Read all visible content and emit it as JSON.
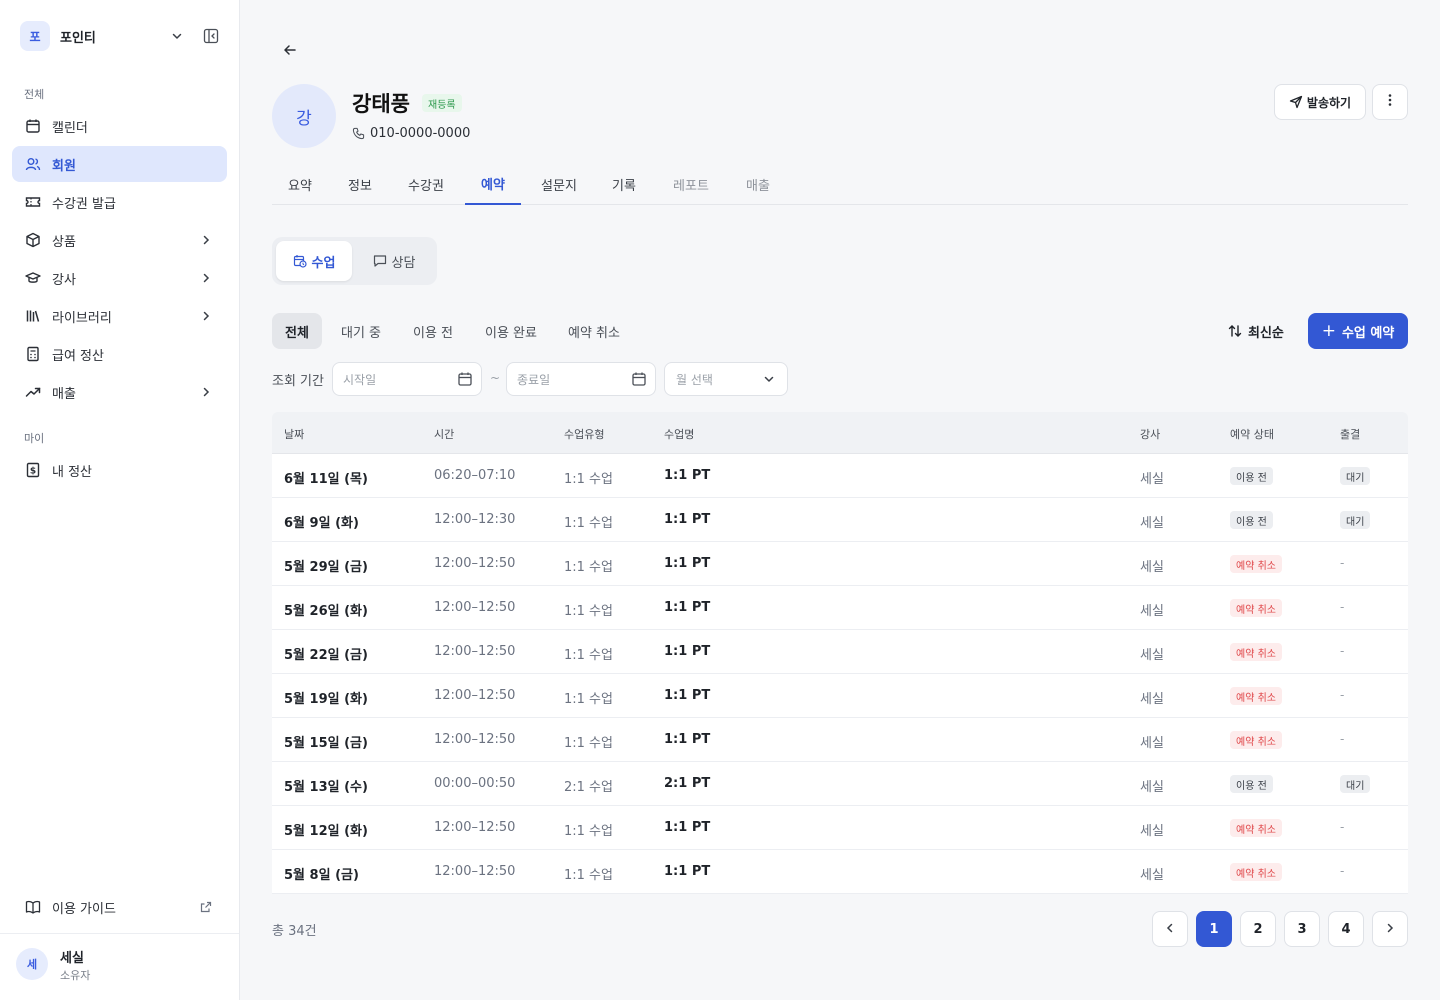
{
  "sidebar": {
    "workspace": {
      "initial": "포",
      "name": "포인티"
    },
    "section_all": "전체",
    "section_my": "마이",
    "items": [
      {
        "label": "캘린더"
      },
      {
        "label": "회원"
      },
      {
        "label": "수강권 발급"
      },
      {
        "label": "상품"
      },
      {
        "label": "강사"
      },
      {
        "label": "라이브러리"
      },
      {
        "label": "급여 정산"
      },
      {
        "label": "매출"
      }
    ],
    "my_items": [
      {
        "label": "내 정산"
      }
    ],
    "guide": {
      "label": "이용 가이드"
    },
    "user": {
      "initial": "세",
      "name": "세실",
      "role": "소유자"
    }
  },
  "member": {
    "initial": "강",
    "name": "강태풍",
    "badge": "재등록",
    "phone": "010-0000-0000"
  },
  "actions": {
    "send_label": "발송하기"
  },
  "tabs": [
    {
      "label": "요약"
    },
    {
      "label": "정보"
    },
    {
      "label": "수강권"
    },
    {
      "label": "예약"
    },
    {
      "label": "설문지"
    },
    {
      "label": "기록"
    },
    {
      "label": "레포트"
    },
    {
      "label": "매출"
    }
  ],
  "active_tab": "예약",
  "segment": [
    {
      "label": "수업"
    },
    {
      "label": "상담"
    }
  ],
  "filters": [
    {
      "label": "전체"
    },
    {
      "label": "대기 중"
    },
    {
      "label": "이용 전"
    },
    {
      "label": "이용 완료"
    },
    {
      "label": "예약 취소"
    }
  ],
  "sort_label": "최신순",
  "reserve_label": "수업 예약",
  "period": {
    "label": "조회 기간",
    "start_placeholder": "시작일",
    "end_placeholder": "종료일",
    "tilde": "~",
    "month_placeholder": "월 선택"
  },
  "table": {
    "headers": {
      "date": "날짜",
      "time": "시간",
      "type": "수업유형",
      "name": "수업명",
      "instructor": "강사",
      "status": "예약 상태",
      "attendance": "출결"
    },
    "rows": [
      {
        "date": "6월 11일 (목)",
        "time": "06:20–07:10",
        "type": "1:1 수업",
        "name": "1:1 PT",
        "instructor": "세실",
        "status": "이용 전",
        "status_color": "grey",
        "attendance": "대기"
      },
      {
        "date": "6월 9일 (화)",
        "time": "12:00–12:30",
        "type": "1:1 수업",
        "name": "1:1 PT",
        "instructor": "세실",
        "status": "이용 전",
        "status_color": "grey",
        "attendance": "대기"
      },
      {
        "date": "5월 29일 (금)",
        "time": "12:00–12:50",
        "type": "1:1 수업",
        "name": "1:1 PT",
        "instructor": "세실",
        "status": "예약 취소",
        "status_color": "red",
        "attendance": "-"
      },
      {
        "date": "5월 26일 (화)",
        "time": "12:00–12:50",
        "type": "1:1 수업",
        "name": "1:1 PT",
        "instructor": "세실",
        "status": "예약 취소",
        "status_color": "red",
        "attendance": "-"
      },
      {
        "date": "5월 22일 (금)",
        "time": "12:00–12:50",
        "type": "1:1 수업",
        "name": "1:1 PT",
        "instructor": "세실",
        "status": "예약 취소",
        "status_color": "red",
        "attendance": "-"
      },
      {
        "date": "5월 19일 (화)",
        "time": "12:00–12:50",
        "type": "1:1 수업",
        "name": "1:1 PT",
        "instructor": "세실",
        "status": "예약 취소",
        "status_color": "red",
        "attendance": "-"
      },
      {
        "date": "5월 15일 (금)",
        "time": "12:00–12:50",
        "type": "1:1 수업",
        "name": "1:1 PT",
        "instructor": "세실",
        "status": "예약 취소",
        "status_color": "red",
        "attendance": "-"
      },
      {
        "date": "5월 13일 (수)",
        "time": "00:00–00:50",
        "type": "2:1 수업",
        "name": "2:1 PT",
        "instructor": "세실",
        "status": "이용 전",
        "status_color": "grey",
        "attendance": "대기"
      },
      {
        "date": "5월 12일 (화)",
        "time": "12:00–12:50",
        "type": "1:1 수업",
        "name": "1:1 PT",
        "instructor": "세실",
        "status": "예약 취소",
        "status_color": "red",
        "attendance": "-"
      },
      {
        "date": "5월 8일 (금)",
        "time": "12:00–12:50",
        "type": "1:1 수업",
        "name": "1:1 PT",
        "instructor": "세실",
        "status": "예약 취소",
        "status_color": "red",
        "attendance": "-"
      }
    ]
  },
  "total": "총 34건",
  "pagination": {
    "pages": [
      "1",
      "2",
      "3",
      "4"
    ],
    "current": "1"
  },
  "colors": {
    "accent": "#3358d4",
    "active_nav_bg": "#dfe7fd",
    "cancel_red": "#e0484a",
    "badge_green": "#2e9a4e"
  },
  "icons": {
    "nav": [
      "calendar-icon",
      "users-icon",
      "ticket-icon",
      "package-icon",
      "graduation-cap-icon",
      "library-icon",
      "receipt-icon",
      "trend-up-icon"
    ],
    "my": [
      "dollar-doc-icon"
    ]
  }
}
